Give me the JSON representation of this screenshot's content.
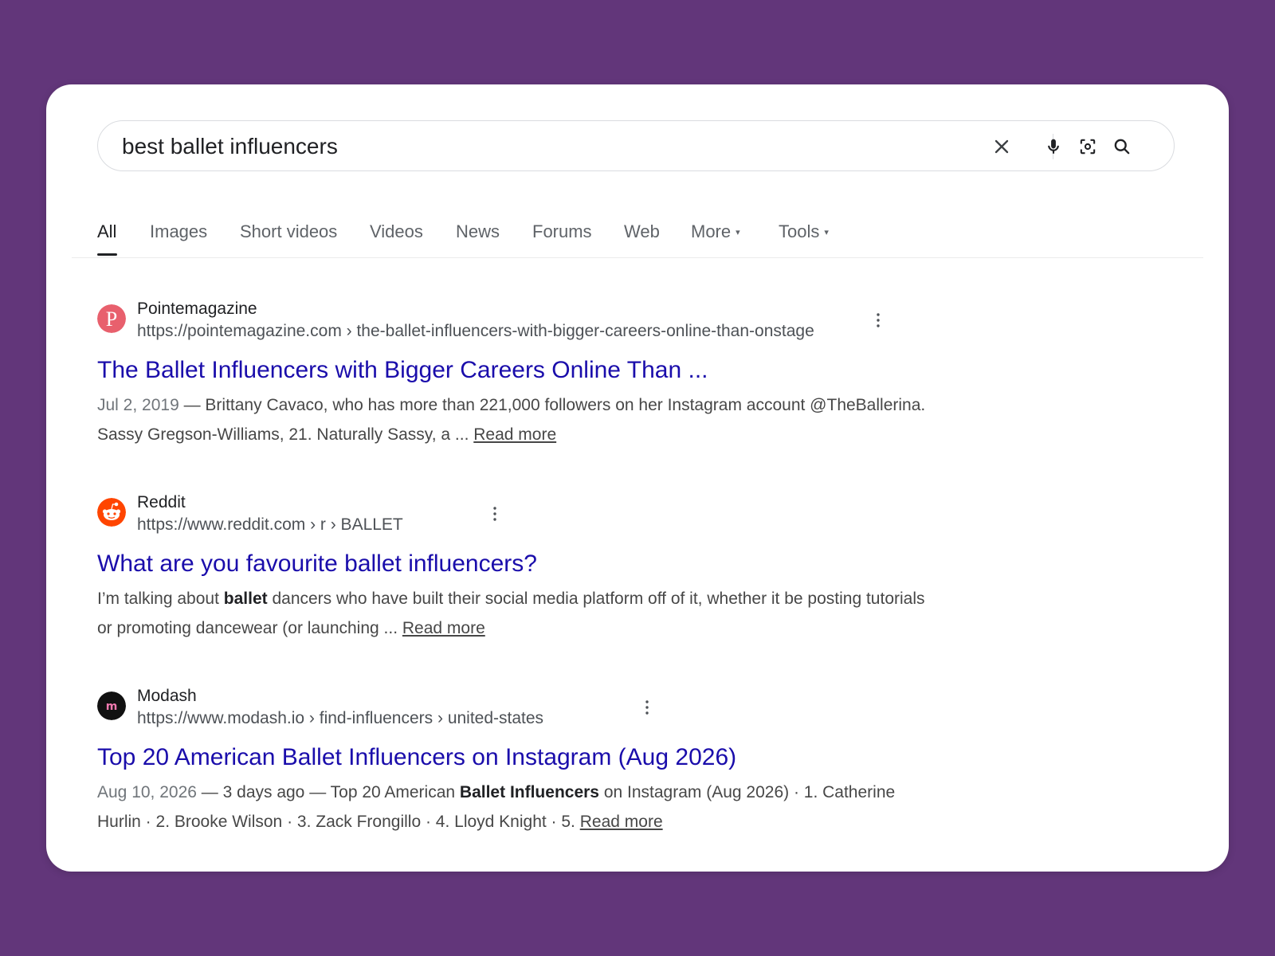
{
  "search": {
    "query": "best ballet influencers",
    "clear_icon": "close-icon",
    "voice_icon": "mic-icon",
    "lens_icon": "camera-lens-icon",
    "submit_icon": "search-icon"
  },
  "tabs": {
    "all": "All",
    "images": "Images",
    "short_videos": "Short videos",
    "videos": "Videos",
    "news": "News",
    "forums": "Forums",
    "web": "Web",
    "more": "More",
    "tools": "Tools"
  },
  "results": [
    {
      "site": "Pointemagazine",
      "url": "https://pointemagazine.com › the-ballet-influencers-with-bigger-careers-online-than-onstage",
      "title": "The Ballet Influencers with Bigger Careers Online Than ...",
      "date": "Jul 2, 2019",
      "snippet_1": " — Brittany Cavaco, who has more than 221,000 followers on her Instagram account @TheBallerina. Sassy Gregson-Williams, 21. Naturally Sassy, a ... ",
      "read_more": "Read more",
      "favicon_color": "#e8606d"
    },
    {
      "site": "Reddit",
      "url": "https://www.reddit.com › r › BALLET",
      "title": "What are you favourite ballet influencers?",
      "snippet_pre": "I’m talking about ",
      "snippet_bold": "ballet",
      "snippet_post": " dancers who have built their social media platform off of it, whether it be posting tutorials or promoting dancewear (or launching ... ",
      "read_more": "Read more",
      "favicon_color": "#ff4500"
    },
    {
      "site": "Modash",
      "url": "https://www.modash.io › find-influencers › united-states",
      "title": "Top 20 American Ballet Influencers on Instagram (Aug 2026)",
      "date": "Aug 10, 2026",
      "snippet_pre": " — 3 days ago — Top 20 American ",
      "snippet_bold": "Ballet Influencers",
      "snippet_post": " on Instagram (Aug 2026) · 1. Catherine Hurlin · 2. Brooke Wilson · 3. Zack Frongillo · 4. Lloyd Knight · 5. ",
      "read_more": "Read more",
      "favicon_text": "m",
      "favicon_color": "#111111"
    }
  ],
  "colors": {
    "background": "#62367a",
    "link": "#1a0dab",
    "text": "#202124"
  }
}
